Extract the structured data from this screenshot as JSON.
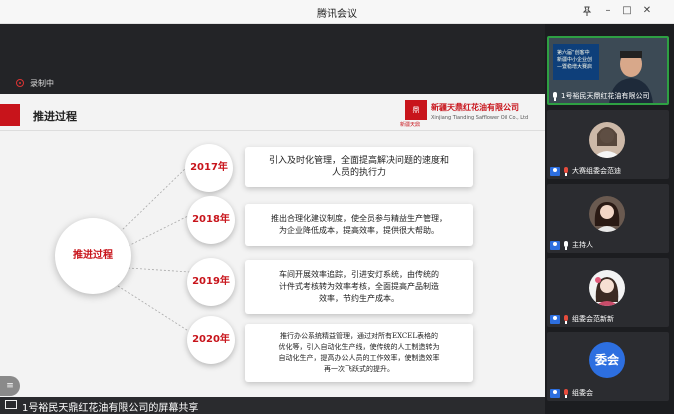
{
  "window": {
    "title": "腾讯会议",
    "controls": [
      "pin-icon",
      "minimize-icon",
      "maximize-icon",
      "close-icon"
    ]
  },
  "recording": {
    "label": "录制中"
  },
  "slide": {
    "title": "推进过程",
    "company_cn": "新疆天鼎红花油有限公司",
    "company_en": "Xinjiang Tianding Safflower Oil Co., Ltd",
    "logo_text": "鼎",
    "logo_sub": "新疆天鼎",
    "hub_label": "推进过程",
    "items": [
      {
        "year": "2017年",
        "lines": [
          "引入及时化管理，全面提高解决问题的速度和",
          "人员的执行力"
        ]
      },
      {
        "year": "2018年",
        "lines": [
          "推出合理化建议制度，使全员参与精益生产管理，",
          "为企业降低成本，提高效率，提供很大帮助。"
        ]
      },
      {
        "year": "2019年",
        "lines": [
          "车间开展效率追踪，引进安灯系统，由传统的",
          "计件式考核转为效率考核，全面提高产品制造",
          "效率，节约生产成本。"
        ]
      },
      {
        "year": "2020年",
        "lines": [
          "推行办公系统精益管理，通过对所有EXCEL表格的",
          "优化等，引入自动化生产线，使传统的人工制造转为",
          "自动化生产，提高办公人员的工作效率，使制造效率",
          "再一次飞跃式的提升。"
        ]
      }
    ]
  },
  "share": {
    "label": "1号裕民天鼎红花油有限公司的屏幕共享"
  },
  "participants": [
    {
      "name": "1号裕民天鼎红花油有限公司",
      "type": "video",
      "banner": [
        "第六届“创客中",
        "新疆中小企业创",
        "—暨稳增大赛启"
      ]
    },
    {
      "name": "大赛组委会范迪",
      "type": "avatar"
    },
    {
      "name": "主持人",
      "type": "avatar"
    },
    {
      "name": "组委会范新新",
      "type": "avatar"
    },
    {
      "name": "组委会",
      "type": "letter",
      "letter": "委会"
    }
  ],
  "colors": {
    "accent": "#c8141b",
    "active_border": "#2ea043",
    "badge": "#2d6fe0"
  }
}
